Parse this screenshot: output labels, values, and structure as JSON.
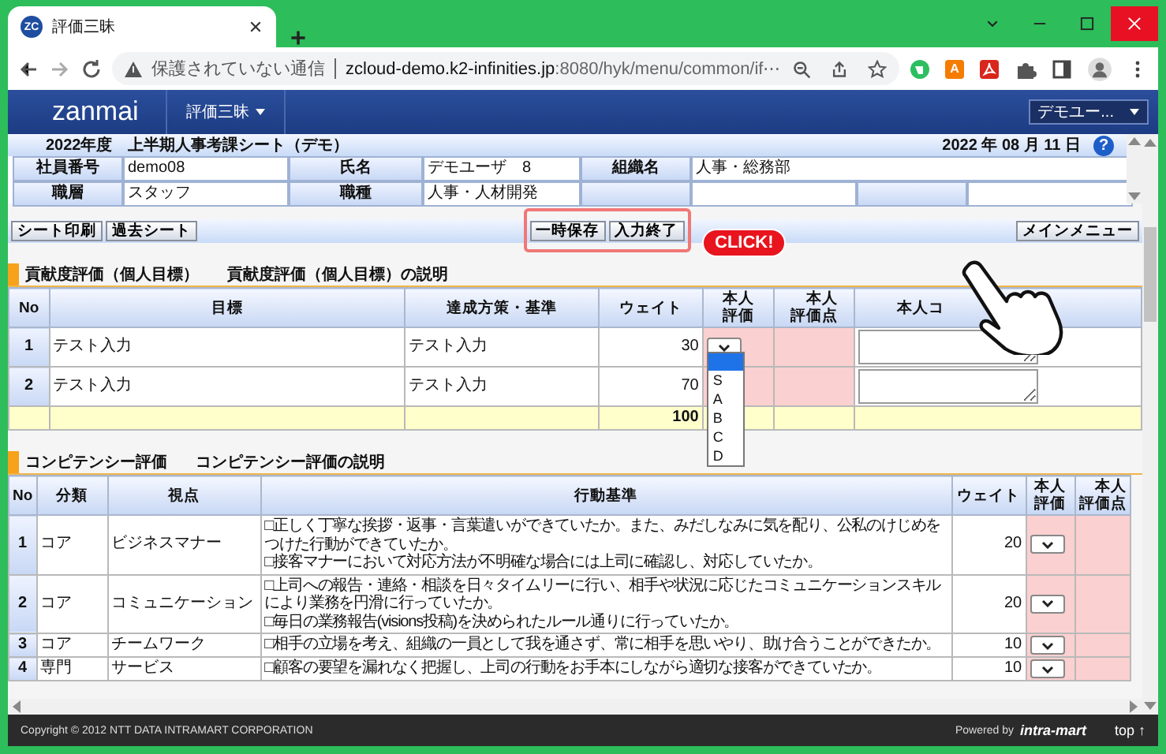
{
  "browser": {
    "tab_badge": "ZC",
    "tab_title": "評価三昧",
    "security": "保護されていない通信",
    "url_host": "zcloud-demo.k2-infinities.jp",
    "url_rest": ":8080/hyk/menu/common/if⋯",
    "extension_badge": "A"
  },
  "app": {
    "logo": "zanmai",
    "menu": "評価三昧",
    "user_menu": "デモユー..."
  },
  "sheet": {
    "title": "2022年度　上半期人事考課シート（デモ）",
    "date": "2022 年 08 月 11 日",
    "help": "?",
    "info_rows": [
      {
        "kind": "span_last",
        "cells": [
          {
            "label": "社員番号",
            "value": "demo08"
          },
          {
            "label": "氏名",
            "value": "デモユーザ　8"
          },
          {
            "label": "組織名",
            "value": "人事・総務部"
          }
        ]
      },
      {
        "kind": "padded",
        "cells": [
          {
            "label": "職層",
            "value": "スタッフ"
          },
          {
            "label": "職種",
            "value": "人事・人材開発"
          }
        ]
      }
    ]
  },
  "toolbar": {
    "left": [
      "シート印刷",
      "過去シート"
    ],
    "center": [
      "一時保存",
      "入力終了"
    ],
    "right": [
      "メインメニュー"
    ],
    "highlight_center": true,
    "callout": "CLICK!"
  },
  "goals": {
    "title": "貢献度評価（個人目標）",
    "link": "貢献度評価（個人目標）の説明",
    "columns": [
      "No",
      "目標",
      "達成方策・基準",
      "ウェイト",
      "本人評価",
      "本人評価点",
      "本人コ"
    ],
    "rows": [
      {
        "no": "1",
        "goal": "テスト入力",
        "measure": "テスト入力",
        "weight": "30",
        "dropdown_open": true
      },
      {
        "no": "2",
        "goal": "テスト入力",
        "measure": "テスト入力",
        "weight": "70",
        "dropdown_open": false
      }
    ],
    "total": "100",
    "dropdown": {
      "blank_highlighted": true,
      "options": [
        "S",
        "A",
        "B",
        "C",
        "D"
      ]
    }
  },
  "competency": {
    "title": "コンピテンシー評価",
    "link": "コンピテンシー評価の説明",
    "columns": [
      "No",
      "分類",
      "視点",
      "行動基準",
      "ウェイト",
      "本人評価",
      "本人評価点"
    ],
    "rows": [
      {
        "no": "1",
        "category": "コア",
        "viewpoint": "ビジネスマナー",
        "criteria": [
          "□正しく丁寧な挨拶・返事・言葉遣いができていたか。また、みだしなみに気を配り、公私のけじめをつけた行動ができていたか。",
          "□接客マナーにおいて対応方法が不明確な場合には上司に確認し、対応していたか。"
        ],
        "weight": "20"
      },
      {
        "no": "2",
        "category": "コア",
        "viewpoint": "コミュニケーション",
        "criteria": [
          "□上司への報告・連絡・相談を日々タイムリーに行い、相手や状況に応じたコミュニケーションスキルにより業務を円滑に行っていたか。",
          "□毎日の業務報告(visions投稿)を決められたルール通りに行っていたか。"
        ],
        "weight": "20"
      },
      {
        "no": "3",
        "category": "コア",
        "viewpoint": "チームワーク",
        "criteria": [
          "□相手の立場を考え、組織の一員として我を通さず、常に相手を思いやり、助け合うことができたか。"
        ],
        "weight": "10"
      },
      {
        "no": "4",
        "category": "専門",
        "viewpoint": "サービス",
        "criteria": [
          "□顧客の要望を漏れなく把握し、上司の行動をお手本にしながら適切な接客ができていたか。"
        ],
        "weight": "10"
      }
    ]
  },
  "footer": {
    "copyright": "Copyright © 2012 NTT DATA INTRAMART CORPORATION",
    "powered": "Powered by",
    "brand": "intra-mart",
    "top": "top ↑"
  }
}
